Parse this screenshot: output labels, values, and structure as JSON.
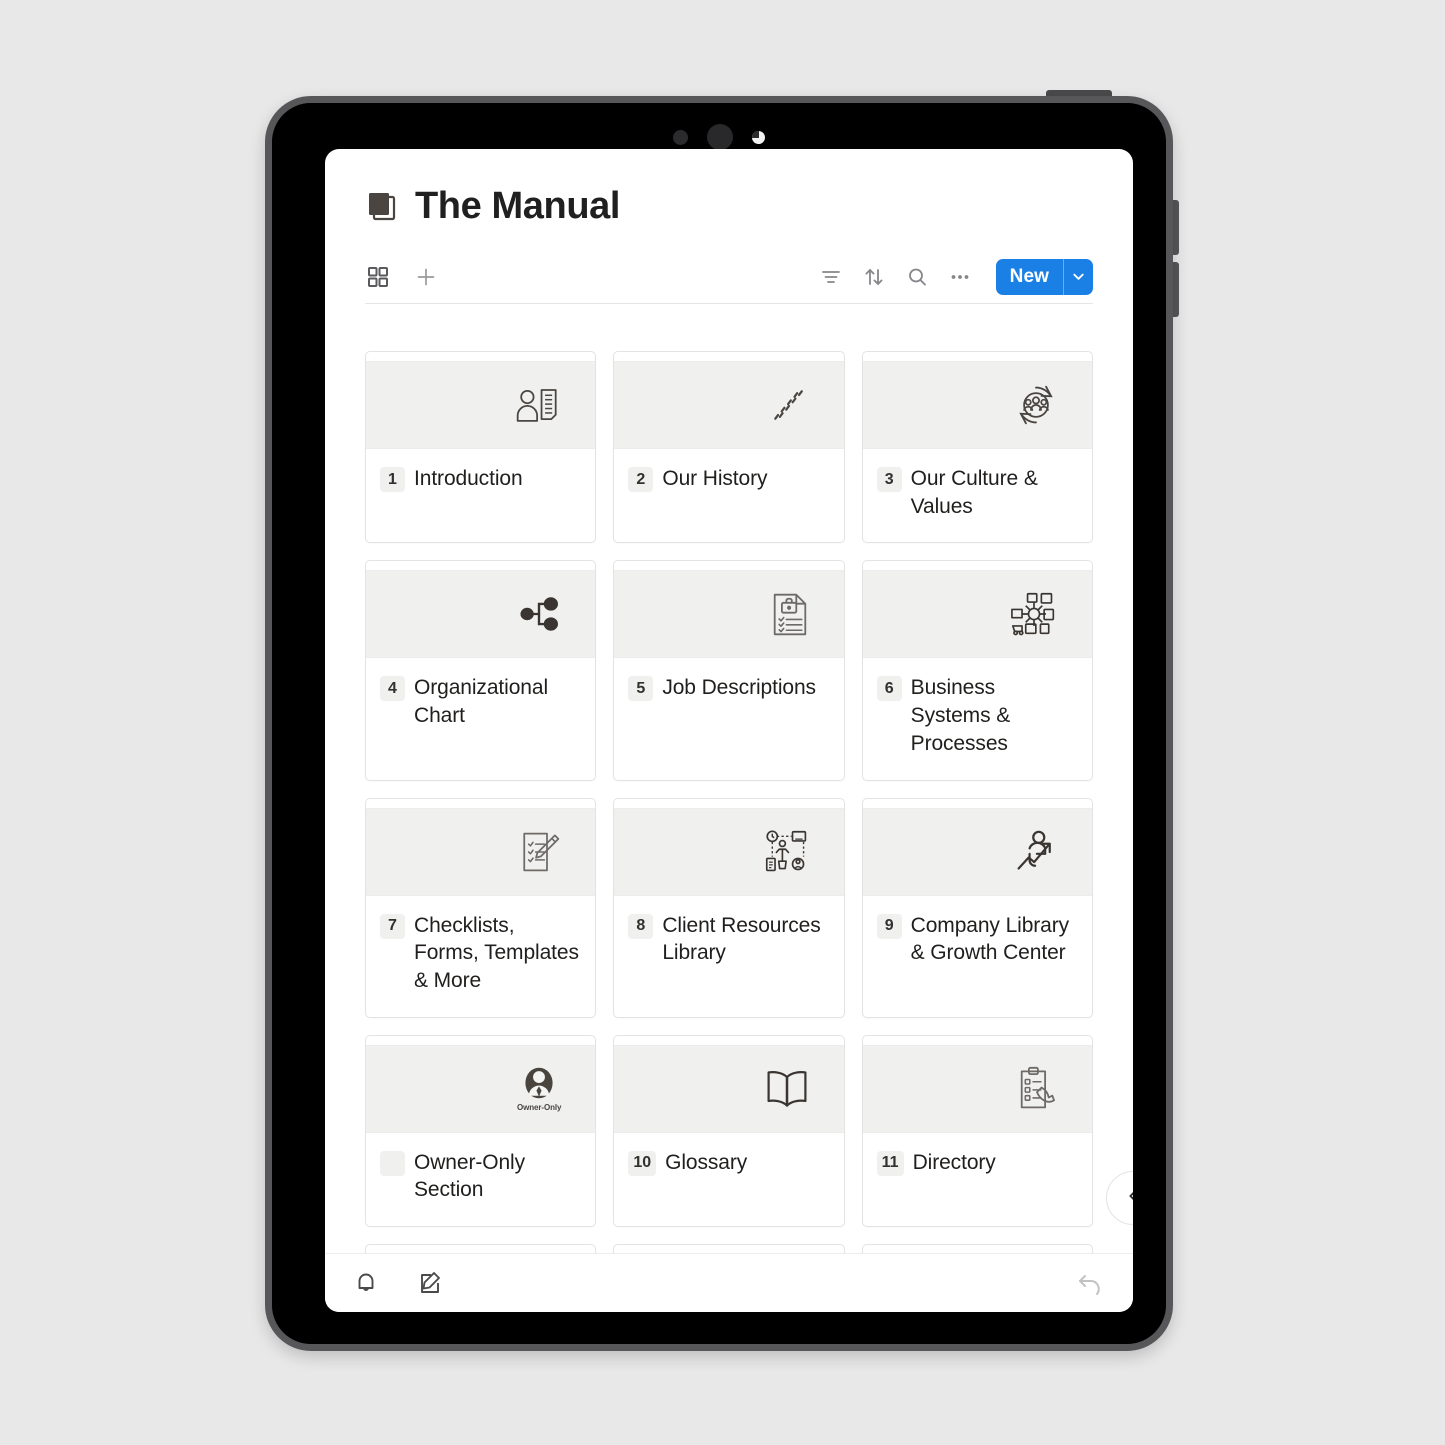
{
  "app": {
    "title": "The Manual",
    "logo_icon": "book-icon"
  },
  "toolbar": {
    "left_items": [
      {
        "name": "grid-view-icon",
        "label": "Grid view"
      },
      {
        "name": "add-view-icon",
        "label": "Add view"
      }
    ],
    "right_items": [
      {
        "name": "filter-icon",
        "label": "Filter"
      },
      {
        "name": "sort-icon",
        "label": "Sort"
      },
      {
        "name": "search-icon",
        "label": "Search"
      },
      {
        "name": "more-options-icon",
        "label": "More options"
      }
    ],
    "new_button": {
      "label": "New",
      "caret_icon": "chevron-down-icon",
      "color": "#1a80e6"
    }
  },
  "colors": {
    "accent": "#1a80e6",
    "cover_bg": "#f0f0ee",
    "card_border": "#e3e3e3",
    "page_bg": "#e8e8e8",
    "text": "#201f1d"
  },
  "cards": [
    {
      "number": "1",
      "label": "Introduction",
      "icon": "person-document-icon"
    },
    {
      "number": "2",
      "label": "Our History",
      "icon": "footprints-icon"
    },
    {
      "number": "3",
      "label": "Our Culture & Values",
      "icon": "team-cycle-icon"
    },
    {
      "number": "4",
      "label": "Organizational Chart",
      "icon": "org-chart-icon"
    },
    {
      "number": "5",
      "label": "Job Descriptions",
      "icon": "briefcase-document-icon"
    },
    {
      "number": "6",
      "label": "Business Systems & Processes",
      "icon": "network-systems-icon"
    },
    {
      "number": "7",
      "label": "Checklists, Forms, Templates & More",
      "icon": "checklist-pencil-icon"
    },
    {
      "number": "8",
      "label": "Client Resources Library",
      "icon": "client-resources-icon"
    },
    {
      "number": "9",
      "label": "Company Library & Growth Center",
      "icon": "person-growth-arrow-icon"
    },
    {
      "number": "",
      "label": "Owner-Only Section",
      "icon": "owner-only-avatar-icon",
      "icon_caption": "Owner-Only"
    },
    {
      "number": "10",
      "label": "Glossary",
      "icon": "open-book-icon"
    },
    {
      "number": "11",
      "label": "Directory",
      "icon": "clipboard-phone-icon"
    },
    {
      "number": "",
      "label": "",
      "icon": "ambulance-icon"
    },
    {
      "number": "",
      "label": "",
      "icon": "feedback-chat-icon"
    },
    {
      "number": "",
      "label": "",
      "icon": "head-checklist-icon"
    }
  ],
  "side_handle": {
    "icon": "chevron-left-icon",
    "label": "Open panel"
  },
  "bottom_bar": {
    "items": [
      {
        "name": "notifications-icon",
        "label": "Notifications"
      },
      {
        "name": "compose-icon",
        "label": "Compose"
      }
    ],
    "undo": {
      "name": "undo-icon",
      "label": "Undo"
    }
  },
  "device": {
    "power_button": "power-button",
    "volume_up": "volume-up-button",
    "volume_down": "volume-down-button"
  }
}
